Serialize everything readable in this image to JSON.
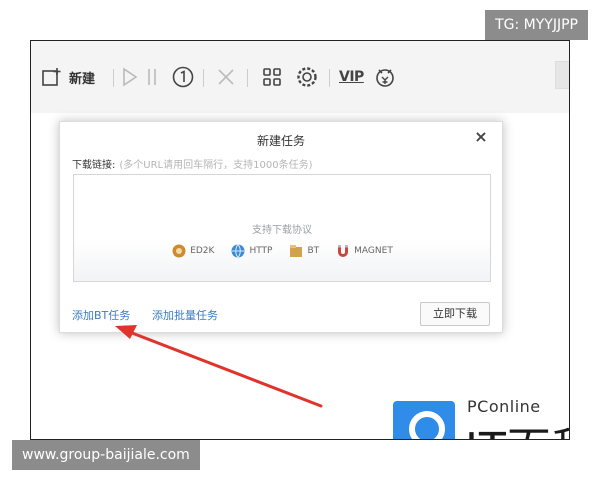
{
  "toolbar": {
    "new_label": "新建",
    "vip_label": "VIP",
    "icons": [
      "new-task-icon",
      "play-icon",
      "pause-icon",
      "limit-speed-icon",
      "delete-icon",
      "apps-grid-icon",
      "settings-icon",
      "vip-icon",
      "skin-icon"
    ]
  },
  "dialog": {
    "title": "新建任务",
    "close_label": "×",
    "link_label": "下载链接:",
    "link_placeholder": "(多个URL请用回车隔行，支持1000条任务)",
    "protocols_title": "支持下载协议",
    "protocols": [
      {
        "name": "ED2K",
        "color": "#d08a2e"
      },
      {
        "name": "HTTP",
        "color": "#3a8ad6"
      },
      {
        "name": "BT",
        "color": "#d2a24a"
      },
      {
        "name": "MAGNET",
        "color": "#c8483e"
      }
    ],
    "add_bt_label": "添加BT任务",
    "add_batch_label": "添加批量任务",
    "download_now_label": "立即下载"
  },
  "watermark": {
    "brand_small": "PConline",
    "brand_big": "IT百科",
    "brand_color": "#2f8ce8"
  },
  "badges": {
    "tg": "TG: MYYJJPP",
    "website": "www.group-baijiale.com"
  }
}
